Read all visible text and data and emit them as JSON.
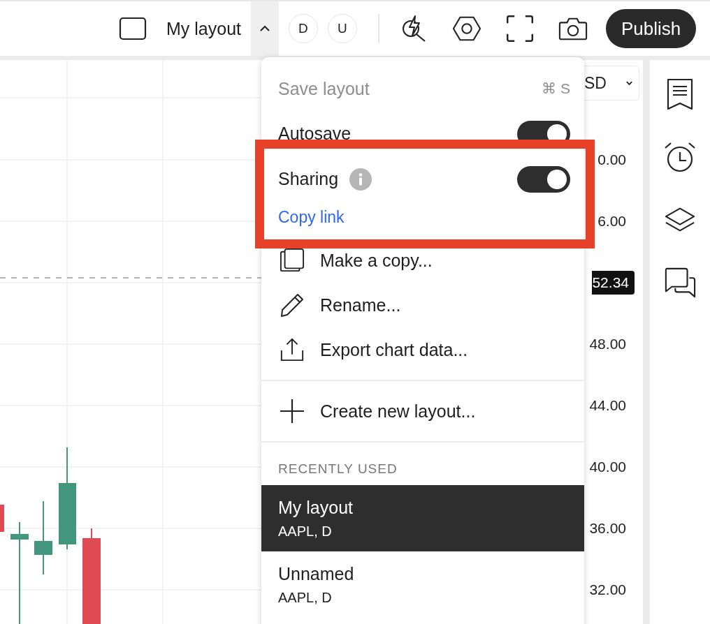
{
  "toolbar": {
    "layout_name": "My layout",
    "avatars": [
      "D",
      "U"
    ],
    "publish": "Publish"
  },
  "menu": {
    "save": {
      "label": "Save layout",
      "shortcut": "⌘ S",
      "disabled": true
    },
    "toggles": [
      {
        "label": "Autosave",
        "on": true,
        "info": false
      },
      {
        "label": "Sharing",
        "on": true,
        "info": true
      }
    ],
    "copy_link": "Copy link",
    "actions": [
      {
        "kind": "copy",
        "label": "Make a copy..."
      },
      {
        "kind": "rename",
        "label": "Rename..."
      },
      {
        "kind": "export",
        "label": "Export chart data..."
      }
    ],
    "create": "Create new layout...",
    "recent_heading": "RECENTLY USED",
    "recent": [
      {
        "name": "My layout",
        "detail": "AAPL, D",
        "selected": true
      },
      {
        "name": "Unnamed",
        "detail": "AAPL, D",
        "selected": false
      }
    ]
  },
  "price_axis": {
    "currency": "SD",
    "labels": [
      {
        "text": "0.00",
        "current": false
      },
      {
        "text": "6.00",
        "current": false
      },
      {
        "text": "52.34",
        "current": true
      },
      {
        "text": "48.00",
        "current": false
      },
      {
        "text": "44.00",
        "current": false
      },
      {
        "text": "40.00",
        "current": false
      },
      {
        "text": "36.00",
        "current": false
      },
      {
        "text": "32.00",
        "current": false
      }
    ]
  }
}
